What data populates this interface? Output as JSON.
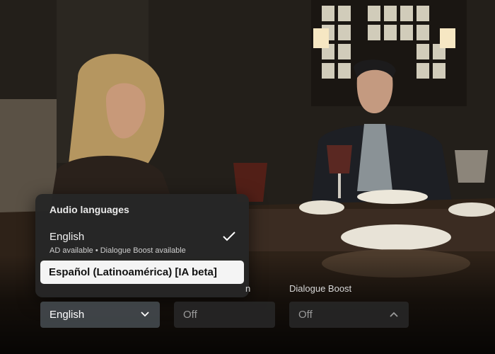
{
  "audio_menu": {
    "title": "Audio languages",
    "options": [
      {
        "label": "English",
        "sublabel": "AD available • Dialogue Boost available",
        "selected": true,
        "icon": "check-icon"
      },
      {
        "label": "Español (Latinoamérica) [IA beta]",
        "highlighted": true
      }
    ]
  },
  "settings": {
    "language": {
      "value": "English",
      "icon": "chevron-down-icon"
    },
    "caption": {
      "label_partial": "n",
      "value": "Off"
    },
    "dialogue_boost": {
      "label": "Dialogue Boost",
      "value": "Off",
      "icon": "chevron-up-icon"
    }
  },
  "colors": {
    "menu_bg": "#262626",
    "highlight_bg": "#f4f4f4",
    "dropdown_active_bg": "#464b50",
    "dropdown_bg": "#282828"
  }
}
